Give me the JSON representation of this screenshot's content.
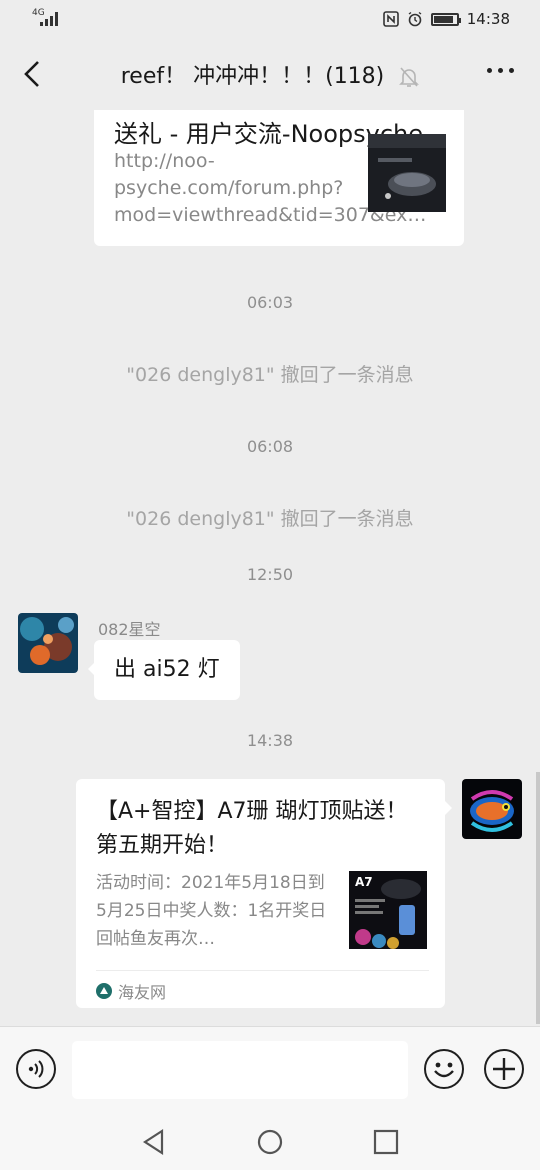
{
  "status_bar": {
    "network": "4G",
    "time": "14:38",
    "icons": [
      "nfc-icon",
      "alarm-icon",
      "battery-icon"
    ]
  },
  "header": {
    "title": "reef！ 冲冲冲！！！(118)",
    "icons": [
      "back-icon",
      "mute-bell-icon",
      "more-icon"
    ]
  },
  "messages": {
    "link_card_top": {
      "title": "送礼 - 用户交流-Noopsyche",
      "description": "http://noo-psyche.com/forum.php?mod=viewthread&tid=307&ex…"
    },
    "time_1": "06:03",
    "recall_1": "\"026 dengly81\" 撤回了一条消息",
    "time_2": "06:08",
    "recall_2": "\"026 dengly81\" 撤回了一条消息",
    "time_3": "12:50",
    "sender_name": "082星空",
    "text_message": "出 ai52 灯",
    "time_4": "14:38",
    "link_card_own": {
      "title": "【A+智控】A7珊 瑚灯顶贴送！第五期开始！",
      "description": "活动时间：2021年5月18日到5月25日中奖人数：1名开奖日回帖鱼友再次…",
      "thumb_text": "A7",
      "source": "海友网"
    }
  },
  "input_bar": {
    "value": "",
    "icons": [
      "voice-icon",
      "emoji-icon",
      "plus-icon"
    ]
  },
  "system_nav": {
    "icons": [
      "nav-back-icon",
      "nav-home-icon",
      "nav-recent-icon"
    ]
  }
}
